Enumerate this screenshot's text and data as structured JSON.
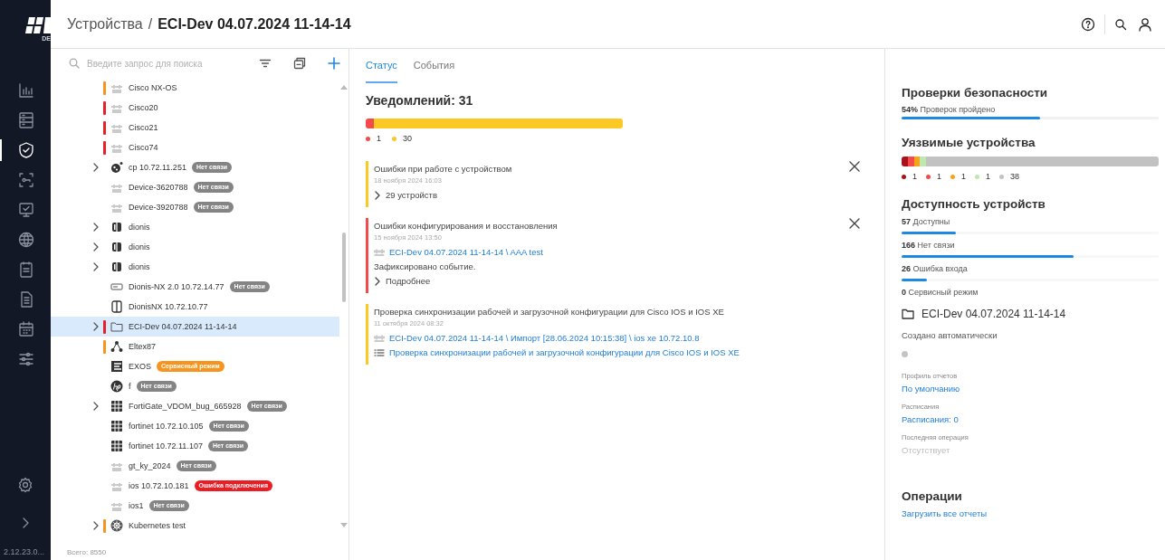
{
  "sidebar": {
    "logo_caption": "DE",
    "items": [
      {
        "kind": "chart",
        "selected": false
      },
      {
        "kind": "server",
        "selected": false
      },
      {
        "kind": "shield",
        "selected": true
      },
      {
        "kind": "scan",
        "selected": false
      },
      {
        "kind": "monitor",
        "selected": false
      },
      {
        "kind": "globe",
        "selected": false
      },
      {
        "kind": "clipboard",
        "selected": false
      },
      {
        "kind": "document",
        "selected": false
      },
      {
        "kind": "calendar",
        "selected": false
      },
      {
        "kind": "sliders",
        "selected": false
      }
    ],
    "version": "2.12.23.0..."
  },
  "header": {
    "parent": "Устройства",
    "separator": "/",
    "current": "ECI-Dev 04.07.2024 11-14-14"
  },
  "tree": {
    "search_placeholder": "Введите запрос для поиска",
    "rows": [
      {
        "label": "Cisco NX-OS",
        "kind": "cisco",
        "expandable": false,
        "color": "#f7931e",
        "selected": false
      },
      {
        "label": "Cisco20",
        "kind": "cisco",
        "expandable": false,
        "color": "#e8202a",
        "selected": false
      },
      {
        "label": "Cisco21",
        "kind": "cisco",
        "expandable": false,
        "color": "#e8202a",
        "selected": false
      },
      {
        "label": "Cisco74",
        "kind": "cisco",
        "expandable": false,
        "color": "#e8202a",
        "selected": false
      },
      {
        "label": "cp 10.72.11.251",
        "kind": "cp",
        "expandable": true,
        "badge": {
          "text": "Нет связи",
          "kind": "offline"
        },
        "selected": false
      },
      {
        "label": "Device-3620788",
        "kind": "cisco",
        "expandable": false,
        "badge": {
          "text": "Нет связи",
          "kind": "offline"
        },
        "selected": false
      },
      {
        "label": "Device-3920788",
        "kind": "cisco",
        "expandable": false,
        "badge": {
          "text": "Нет связи",
          "kind": "offline"
        },
        "selected": false
      },
      {
        "label": "dionis",
        "kind": "dionis",
        "expandable": true,
        "selected": false
      },
      {
        "label": "dionis",
        "kind": "dionis",
        "expandable": true,
        "selected": false
      },
      {
        "label": "dionis",
        "kind": "dionis",
        "expandable": true,
        "selected": false
      },
      {
        "label": "Dionis-NX 2.0 10.72.14.77",
        "kind": "rack",
        "expandable": false,
        "badge": {
          "text": "Нет связи",
          "kind": "offline"
        },
        "selected": false
      },
      {
        "label": "DionisNX 10.72.10.77",
        "kind": "dionisnx",
        "expandable": false,
        "selected": false
      },
      {
        "label": "ECI-Dev 04.07.2024 11-14-14",
        "kind": "folder",
        "expandable": true,
        "color": "#e8202a",
        "selected": true
      },
      {
        "label": "Eltex87",
        "kind": "eltex",
        "expandable": false,
        "color": "#f7931e",
        "selected": false
      },
      {
        "label": "EXOS",
        "kind": "exos",
        "expandable": false,
        "badge": {
          "text": "Сервисный режим",
          "kind": "service"
        },
        "selected": false
      },
      {
        "label": "f",
        "kind": "hp",
        "expandable": false,
        "badge": {
          "text": "Нет связи",
          "kind": "offline"
        },
        "selected": false
      },
      {
        "label": "FortiGate_VDOM_bug_665928",
        "kind": "fortinet",
        "expandable": true,
        "badge": {
          "text": "Нет связи",
          "kind": "offline"
        },
        "selected": false
      },
      {
        "label": "fortinet 10.72.10.105",
        "kind": "fortinet",
        "expandable": false,
        "badge": {
          "text": "Нет связи",
          "kind": "offline"
        },
        "selected": false
      },
      {
        "label": "fortinet 10.72.11.107",
        "kind": "fortinet",
        "expandable": false,
        "badge": {
          "text": "Нет связи",
          "kind": "offline"
        },
        "selected": false
      },
      {
        "label": "gt_ky_2024",
        "kind": "cisco",
        "expandable": false,
        "badge": {
          "text": "Нет связи",
          "kind": "offline"
        },
        "selected": false
      },
      {
        "label": "ios 10.72.10.181",
        "kind": "cisco",
        "expandable": false,
        "badge": {
          "text": "Ошибка подключения",
          "kind": "error"
        },
        "selected": false
      },
      {
        "label": "ios1",
        "kind": "cisco",
        "expandable": false,
        "badge": {
          "text": "Нет связи",
          "kind": "offline"
        },
        "selected": false
      },
      {
        "label": "Kubernetes test",
        "kind": "kubernetes",
        "expandable": true,
        "color": "#f7931e",
        "selected": false
      }
    ],
    "total": "Всего: 8550"
  },
  "tabs": [
    {
      "label": "Статус",
      "selected": true
    },
    {
      "label": "События",
      "selected": false
    }
  ],
  "notifications": {
    "title": "Уведомлений: 31",
    "segments": [
      {
        "color": "#f44a4a",
        "count": "1",
        "level": 0.032
      },
      {
        "color": "#fcc824",
        "count": "30",
        "level": 0.968
      }
    ],
    "items": [
      {
        "color": "#fcc824",
        "title": "Ошибки при работе с устройством",
        "date": "18 ноября 2024 16:03",
        "closable": true,
        "lines": [
          {
            "kind": "expander",
            "text": "29 устройств"
          }
        ]
      },
      {
        "color": "#f44a4a",
        "title": "Ошибки конфигурирования и восстановления",
        "date": "15 ноября 2024 13:50",
        "closable": true,
        "lines": [
          {
            "kind": "device_link",
            "text": "ECI-Dev 04.07.2024 11-14-14 \\ AAA test"
          },
          {
            "kind": "text",
            "text": "Зафиксировано событие."
          },
          {
            "kind": "expander",
            "text": "Подробнее"
          }
        ]
      },
      {
        "color": "#fcc824",
        "title": "Проверка синхронизации рабочей и загрузочной конфигурации для Cisco IOS и IOS XE",
        "date": "11 октября 2024 08:32",
        "closable": false,
        "lines": [
          {
            "kind": "device_link",
            "text": "ECI-Dev 04.07.2024 11-14-14 \\ Импорт [28.06.2024 10:15:38] \\ ios xe 10.72.10.8"
          },
          {
            "kind": "check_link",
            "text": "Проверка синхронизации рабочей и загрузочной конфигурации для Cisco IOS и IOS XE"
          }
        ]
      }
    ]
  },
  "security": {
    "title": "Проверки безопасности",
    "text": "**54%** Проверок пройдено",
    "level": 0.54
  },
  "vulnerable": {
    "title": "Уязвимые устройства",
    "segments": [
      {
        "color": "#a8121c",
        "count": "1"
      },
      {
        "color": "#f44a4a",
        "count": "1"
      },
      {
        "color": "#f7a21b",
        "count": "1"
      },
      {
        "color": "#bfe8ac",
        "count": "1"
      },
      {
        "color": "#c2c2c2",
        "count": "38"
      }
    ]
  },
  "availability": {
    "title": "Доступность устройств",
    "items": [
      {
        "text": "**57** Доступны",
        "level": 0.21
      },
      {
        "text": "**166** Нет связи",
        "level": 0.67
      },
      {
        "text": "**26** Ошибка входа",
        "level": 0.1
      },
      {
        "text": "**0** Сервисный режим"
      }
    ]
  },
  "group": {
    "name": "ECI-Dev 04.07.2024 11-14-14",
    "origin": "Создано автоматически",
    "status_dot": {
      "color": "#c4c4c4"
    },
    "properties": [
      {
        "label": "Профиль отчетов",
        "value": "По умолчанию",
        "kind": "link"
      },
      {
        "label": "Расписания",
        "value": "Расписания: 0",
        "kind": "link"
      },
      {
        "label": "Последняя операция",
        "value": "Отсутствует",
        "kind": "muted"
      }
    ]
  },
  "operations": {
    "title": "Операции",
    "link": "Загрузить все отчеты"
  }
}
